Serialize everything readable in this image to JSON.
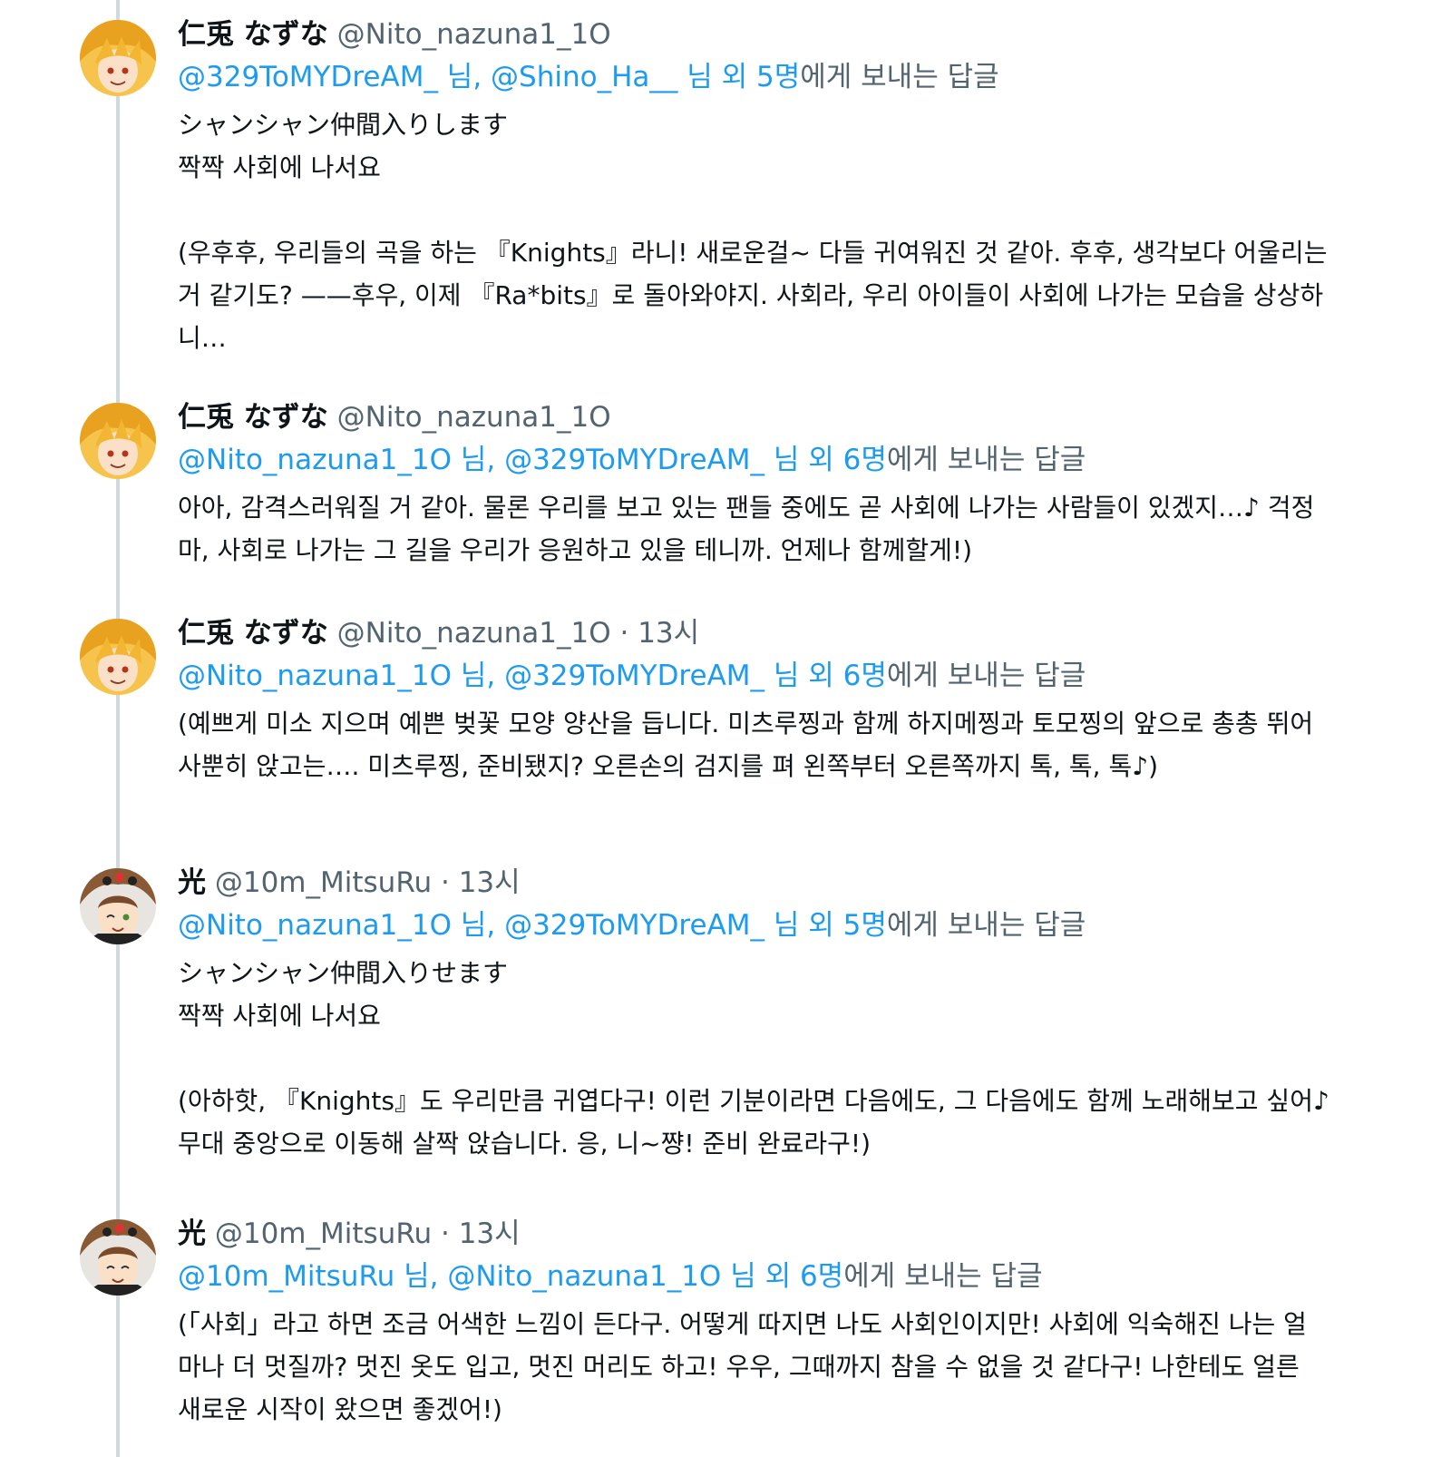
{
  "tweets": [
    {
      "name": "仁兎 なずな",
      "handle": "@Nito_nazuna1_1O",
      "time": "",
      "reply": {
        "m1": "@329ToMYDreAM_",
        "sep1": " 님, ",
        "m2": "@Shino_Ha__",
        "sep2": " 님 외 ",
        "count": "5명",
        "suffix": "에게 보내는 답글"
      },
      "body": "シャンシャン仲間入りします\n짝짝 사회에 나서요\n\n(우후후, 우리들의 곡을 하는 『Knights』라니! 새로운걸~ 다들 귀여워진 것 같아. 후후, 생각보다 어울리는 거 같기도? ——후우, 이제 『Ra*bits』로 돌아와야지. 사회라, 우리 아이들이 사회에 나가는 모습을 상상하니…"
    },
    {
      "name": "仁兎 なずな",
      "handle": "@Nito_nazuna1_1O",
      "time": "",
      "reply": {
        "m1": "@Nito_nazuna1_1O",
        "sep1": " 님, ",
        "m2": "@329ToMYDreAM_",
        "sep2": " 님 외 ",
        "count": "6명",
        "suffix": "에게 보내는 답글"
      },
      "body": "아아, 감격스러워질 거 같아. 물론 우리를 보고 있는 팬들 중에도 곧 사회에 나가는 사람들이 있겠지…♪ 걱정 마, 사회로 나가는 그 길을 우리가 응원하고 있을 테니까. 언제나 함께할게!)"
    },
    {
      "name": "仁兎 なずな",
      "handle": "@Nito_nazuna1_1O",
      "time": "13시",
      "reply": {
        "m1": "@Nito_nazuna1_1O",
        "sep1": " 님, ",
        "m2": "@329ToMYDreAM_",
        "sep2": " 님 외 ",
        "count": "6명",
        "suffix": "에게 보내는 답글"
      },
      "body": "(예쁘게 미소 지으며 예쁜 벚꽃 모양 양산을 듭니다. 미츠루찡과 함께 하지메찡과 토모찡의 앞으로 총총 뛰어 사뿐히 앉고는…. 미츠루찡, 준비됐지? 오른손의 검지를 펴 왼쪽부터 오른쪽까지 톡, 톡, 톡♪)"
    },
    {
      "name": "光",
      "handle": "@10m_MitsuRu",
      "time": "13시",
      "reply": {
        "m1": "@Nito_nazuna1_1O",
        "sep1": " 님, ",
        "m2": "@329ToMYDreAM_",
        "sep2": " 님 외 ",
        "count": "5명",
        "suffix": "에게 보내는 답글"
      },
      "body": "シャンシャン仲間入りせます\n짝짝 사회에 나서요\n\n(아하핫, 『Knights』도 우리만큼 귀엽다구! 이런 기분이라면 다음에도, 그 다음에도 함께 노래해보고 싶어♪ 무대 중앙으로 이동해 살짝 앉습니다. 응, 니~쨩! 준비 완료라구!)"
    },
    {
      "name": "光",
      "handle": "@10m_MitsuRu",
      "time": "13시",
      "reply": {
        "m1": "@10m_MitsuRu",
        "sep1": " 님, ",
        "m2": "@Nito_nazuna1_1O",
        "sep2": " 님 외 ",
        "count": "6명",
        "suffix": "에게 보내는 답글"
      },
      "body": "(「사회」라고 하면 조금 어색한 느낌이 든다구. 어떻게 따지면 나도 사회인이지만! 사회에 익숙해진 나는 얼마나 더 멋질까? 멋진 옷도 입고, 멋진 머리도 하고! 우우, 그때까지 참을 수 없을 것 같다구! 나한테도 얼른 새로운 시작이 왔으면 좋겠어!)"
    }
  ],
  "time_separator": " · ",
  "colors": {
    "text": "#0f1419",
    "secondary": "#536471",
    "link": "#1d9bf0",
    "thread_line": "#cfd9de"
  }
}
